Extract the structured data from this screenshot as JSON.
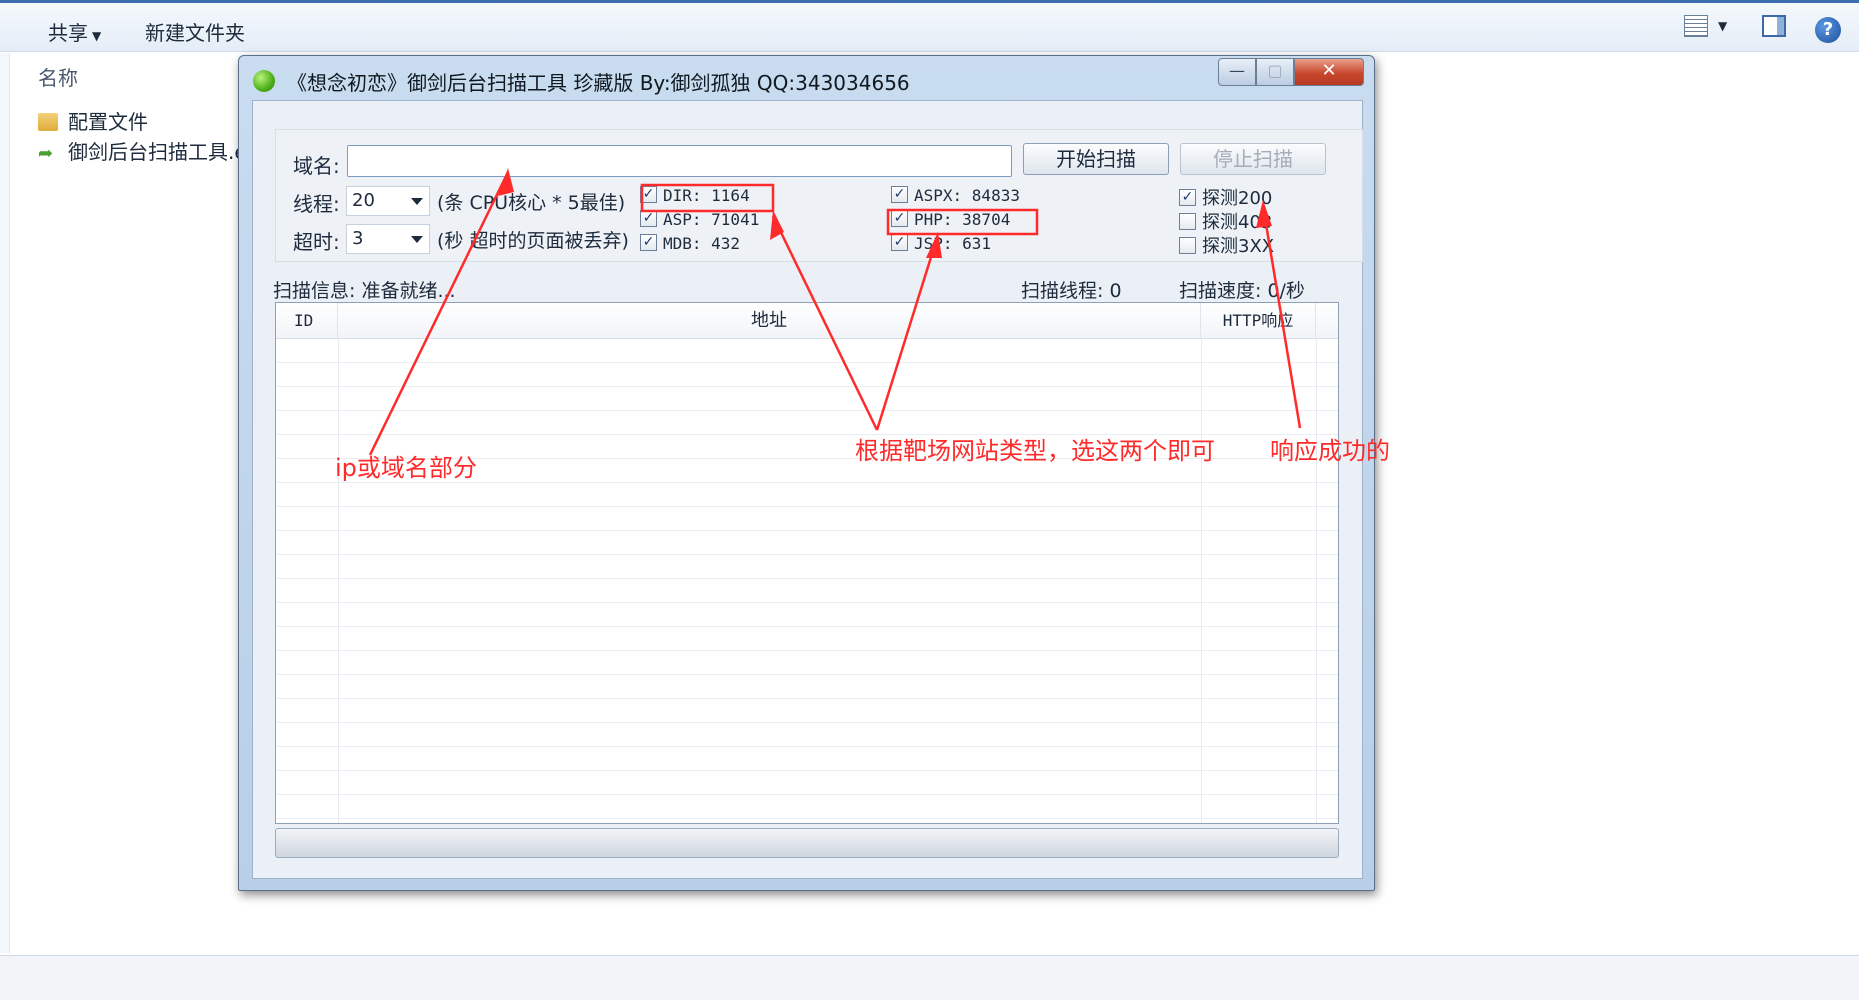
{
  "explorer": {
    "toolbar": {
      "share_label": "共享",
      "new_folder_label": "新建文件夹"
    },
    "list_header": "名称",
    "files": [
      {
        "name": "配置文件",
        "icon": "folder-icon"
      },
      {
        "name": "御剑后台扫描工具.exe",
        "icon": "shortcut-arrow-icon"
      }
    ],
    "help_glyph": "?"
  },
  "window": {
    "title": "《想念初恋》御剑后台扫描工具 珍藏版 By:御剑孤独 QQ:343034656",
    "controls": {
      "minimize": "—",
      "maximize": "▢",
      "close": "✕"
    }
  },
  "form": {
    "domain_label": "域名:",
    "domain_value": "",
    "start_button": "开始扫描",
    "stop_button": "停止扫描",
    "threads_label": "线程:",
    "threads_value": "20",
    "threads_hint": "(条 CPU核心 * 5最佳)",
    "timeout_label": "超时:",
    "timeout_value": "3",
    "timeout_hint": "(秒 超时的页面被丢弃)"
  },
  "dictionaries": [
    {
      "id": "dir",
      "label": "DIR: 1164",
      "checked": true
    },
    {
      "id": "asp",
      "label": "ASP: 71041",
      "checked": true
    },
    {
      "id": "mdb",
      "label": "MDB: 432",
      "checked": true
    },
    {
      "id": "aspx",
      "label": "ASPX: 84833",
      "checked": true
    },
    {
      "id": "php",
      "label": "PHP: 38704",
      "checked": true
    },
    {
      "id": "jsp",
      "label": "JSP: 631",
      "checked": true
    }
  ],
  "probes": [
    {
      "id": "200",
      "label": "探测200",
      "checked": true
    },
    {
      "id": "403",
      "label": "探测403",
      "checked": false
    },
    {
      "id": "3xx",
      "label": "探测3XX",
      "checked": false
    }
  ],
  "status": {
    "info": "扫描信息: 准备就绪...",
    "threads": "扫描线程: 0",
    "speed": "扫描速度: 0/秒"
  },
  "table": {
    "columns": [
      "ID",
      "地址",
      "HTTP响应"
    ],
    "rows": []
  },
  "annotations": {
    "color": "#ff2b2b",
    "domain_note": "ip或域名部分",
    "types_note": "根据靶场网站类型，选这两个即可",
    "success_note": "响应成功的"
  }
}
